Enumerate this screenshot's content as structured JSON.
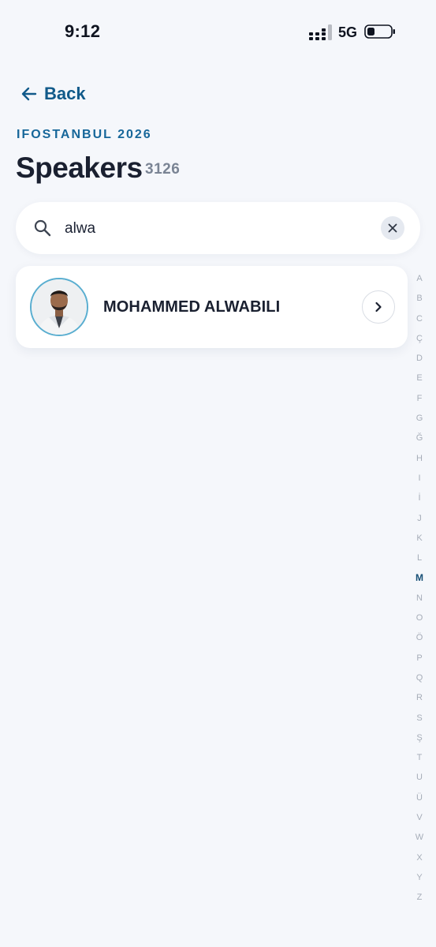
{
  "status_bar": {
    "time": "9:12",
    "network": "5G"
  },
  "nav": {
    "back_label": "Back"
  },
  "header": {
    "event_name": "IFOSTANBUL 2026",
    "title": "Speakers",
    "count": "3126"
  },
  "search": {
    "value": "alwa"
  },
  "speakers": [
    {
      "name": "MOHAMMED ALWABILI"
    }
  ],
  "alpha_index": {
    "letters": [
      "A",
      "B",
      "C",
      "Ç",
      "D",
      "E",
      "F",
      "G",
      "Ğ",
      "H",
      "I",
      "İ",
      "J",
      "K",
      "L",
      "M",
      "N",
      "O",
      "Ö",
      "P",
      "Q",
      "R",
      "S",
      "Ş",
      "T",
      "U",
      "Ü",
      "V",
      "W",
      "X",
      "Y",
      "Z"
    ],
    "active": "M"
  },
  "colors": {
    "accent": "#115a8a",
    "background": "#f5f7fb",
    "card": "#ffffff",
    "avatar_ring": "#5aaed0"
  }
}
